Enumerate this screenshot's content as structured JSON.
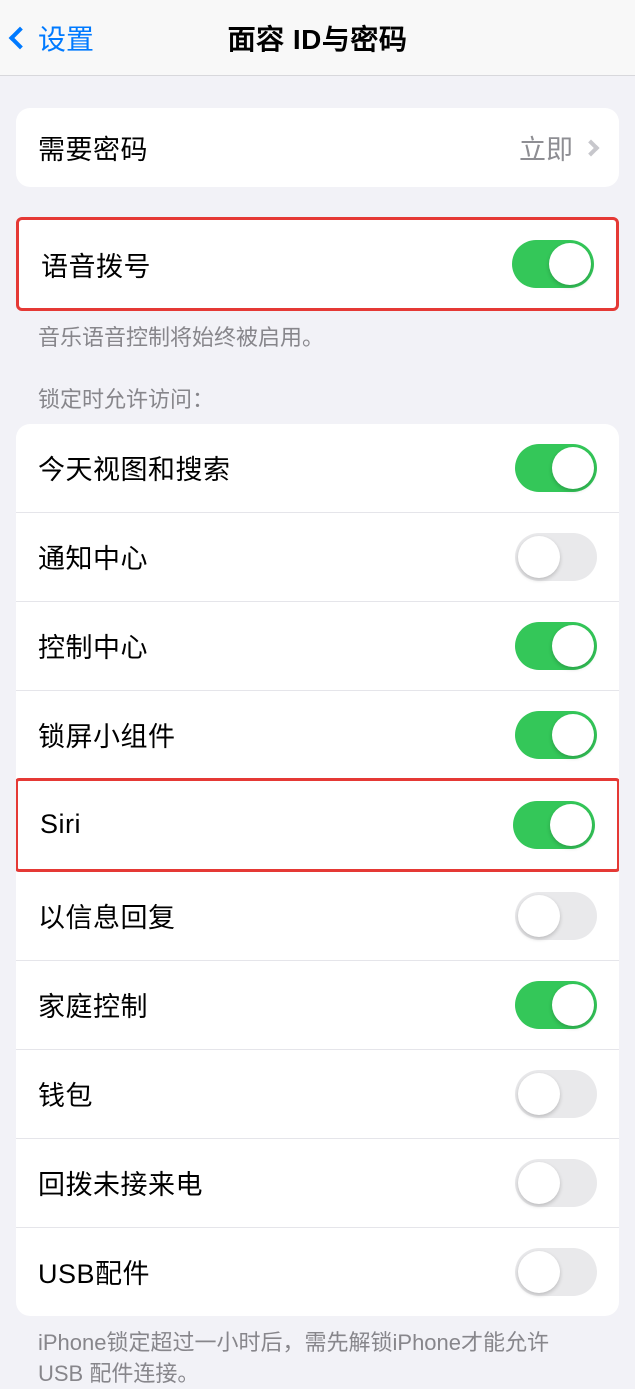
{
  "header": {
    "back_label": "设置",
    "title": "面容 ID与密码"
  },
  "require_passcode": {
    "label": "需要密码",
    "value": "立即"
  },
  "voice_dial": {
    "label": "语音拨号",
    "enabled": true,
    "footer": "音乐语音控制将始终被启用。"
  },
  "locked_access": {
    "header": "锁定时允许访问：",
    "items": [
      {
        "label": "今天视图和搜索",
        "enabled": true
      },
      {
        "label": "通知中心",
        "enabled": false
      },
      {
        "label": "控制中心",
        "enabled": true
      },
      {
        "label": "锁屏小组件",
        "enabled": true
      },
      {
        "label": "Siri",
        "enabled": true
      },
      {
        "label": "以信息回复",
        "enabled": false
      },
      {
        "label": "家庭控制",
        "enabled": true
      },
      {
        "label": "钱包",
        "enabled": false
      },
      {
        "label": "回拨未接来电",
        "enabled": false
      },
      {
        "label": "USB配件",
        "enabled": false
      }
    ],
    "footer": "iPhone锁定超过一小时后，需先解锁iPhone才能允许 USB 配件连接。"
  }
}
